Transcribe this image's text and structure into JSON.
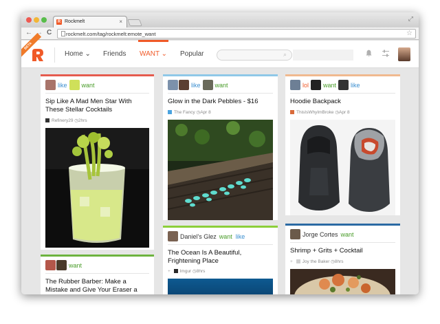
{
  "browser": {
    "tab_title": "Rockmelt",
    "tab_favicon": "R",
    "tab_close": "×",
    "expand_icon": "⤢",
    "url": "rockmelt.com/tag/rockmelt:emote_want",
    "back": "←",
    "forward": "→",
    "reload": "C",
    "star": "☆",
    "traffic_colors": [
      "#ee5a52",
      "#f2b636",
      "#58bd4a"
    ]
  },
  "appnav": {
    "beta_label": "BETA",
    "items": [
      {
        "label": "Home",
        "has_caret": true
      },
      {
        "label": "Friends",
        "has_caret": false
      },
      {
        "label": "WANT",
        "has_caret": true,
        "active": true
      },
      {
        "label": "Popular",
        "has_caret": false
      }
    ],
    "caret": "⌄",
    "search_icon": "⌕",
    "bell_icon": "🔔",
    "settings_icon": "☰",
    "accent": "#f05a28"
  },
  "cards": [
    {
      "accent": "#e55b4e",
      "actions": [
        {
          "avatar_color": "#a8746a",
          "emote": "like",
          "emote_class": "like"
        },
        {
          "avatar_color": "#cfe05a",
          "emote": "want",
          "emote_class": "want"
        }
      ],
      "title": "Sip Like A Mad Men Star With These Stellar Cocktails",
      "source": "Refinery29",
      "age": "2hrs",
      "icon": "drink-photo"
    },
    {
      "accent": "#8fc8e8",
      "actions": [
        {
          "avatar_color": "#7c91ab",
          "emote": "",
          "emote_class": ""
        },
        {
          "avatar_color": "#5b3f32",
          "emote": "like",
          "emote_class": "like"
        },
        {
          "avatar_color": "#6a6a5a",
          "emote": "want",
          "emote_class": "want"
        }
      ],
      "title": "Glow in the Dark Pebbles - $16",
      "source": "The Fancy",
      "age": "Apr 8",
      "icon": "pebbles-photo"
    },
    {
      "accent": "#f0b98f",
      "actions": [
        {
          "avatar_color": "#6d7f95",
          "emote": "lol",
          "emote_class": "lol"
        },
        {
          "avatar_color": "#222222",
          "emote": "want",
          "emote_class": "want"
        },
        {
          "avatar_color": "#333333",
          "emote": "like",
          "emote_class": "like"
        }
      ],
      "title": "Hoodie Backpack",
      "source": "ThisIsWhyImBroke",
      "age": "Apr 8",
      "icon": "backpack-photo"
    },
    {
      "accent": "#6db33f",
      "actions": [
        {
          "avatar_color": "#b4574a",
          "emote": "",
          "emote_class": ""
        },
        {
          "avatar_color": "#4a3a2a",
          "emote": "want",
          "emote_class": "want"
        }
      ],
      "title": "The Rubber Barber: Make a Mistake and Give Your Eraser a",
      "source": "",
      "age": ""
    },
    {
      "accent": "#8ccf3a",
      "actions": [
        {
          "avatar_color": "#7a6252",
          "emote": "want",
          "emote_class": "want",
          "name": "Daniel's Glez"
        },
        {
          "avatar_color": "",
          "emote": "like",
          "emote_class": "like"
        }
      ],
      "title": "The Ocean Is A Beautiful, Frightening Place",
      "source": "Imgur",
      "age": "8hrs"
    },
    {
      "accent": "#2b6aa3",
      "actions": [
        {
          "avatar_color": "#6b5a4a",
          "emote": "want",
          "emote_class": "want",
          "name": "Jorge Cortes"
        }
      ],
      "title": "Shrimp + Grits + Cocktail",
      "source": "Joy the Baker",
      "age": "8hrs"
    }
  ],
  "clock_icon": "◷"
}
